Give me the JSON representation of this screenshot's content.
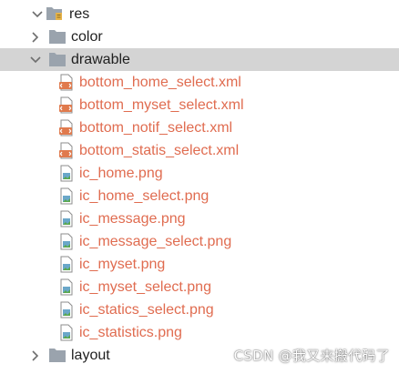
{
  "colors": {
    "selected_row_bg": "#d4d4d4",
    "changed_file_text": "#e06c50",
    "folder_icon": "#9aa3ad",
    "xml_icon": "#e07a4d",
    "png_icon": "#6aa7c9"
  },
  "tree": {
    "res": {
      "label": "res",
      "icon": "resource-folder-icon",
      "expanded": true
    },
    "color": {
      "label": "color",
      "icon": "folder-icon",
      "expanded": false
    },
    "drawable": {
      "label": "drawable",
      "icon": "folder-icon",
      "expanded": true,
      "selected": true
    },
    "drawable_files": [
      {
        "label": "bottom_home_select.xml",
        "icon": "xml-file-icon"
      },
      {
        "label": "bottom_myset_select.xml",
        "icon": "xml-file-icon"
      },
      {
        "label": "bottom_notif_select.xml",
        "icon": "xml-file-icon"
      },
      {
        "label": "bottom_statis_select.xml",
        "icon": "xml-file-icon"
      },
      {
        "label": "ic_home.png",
        "icon": "png-file-icon"
      },
      {
        "label": "ic_home_select.png",
        "icon": "png-file-icon"
      },
      {
        "label": "ic_message.png",
        "icon": "png-file-icon"
      },
      {
        "label": "ic_message_select.png",
        "icon": "png-file-icon"
      },
      {
        "label": "ic_myset.png",
        "icon": "png-file-icon"
      },
      {
        "label": "ic_myset_select.png",
        "icon": "png-file-icon"
      },
      {
        "label": "ic_statics_select.png",
        "icon": "png-file-icon"
      },
      {
        "label": "ic_statistics.png",
        "icon": "png-file-icon"
      }
    ],
    "layout": {
      "label": "layout",
      "icon": "folder-icon",
      "expanded": false
    }
  },
  "watermark": "CSDN @我又来搬代码了"
}
